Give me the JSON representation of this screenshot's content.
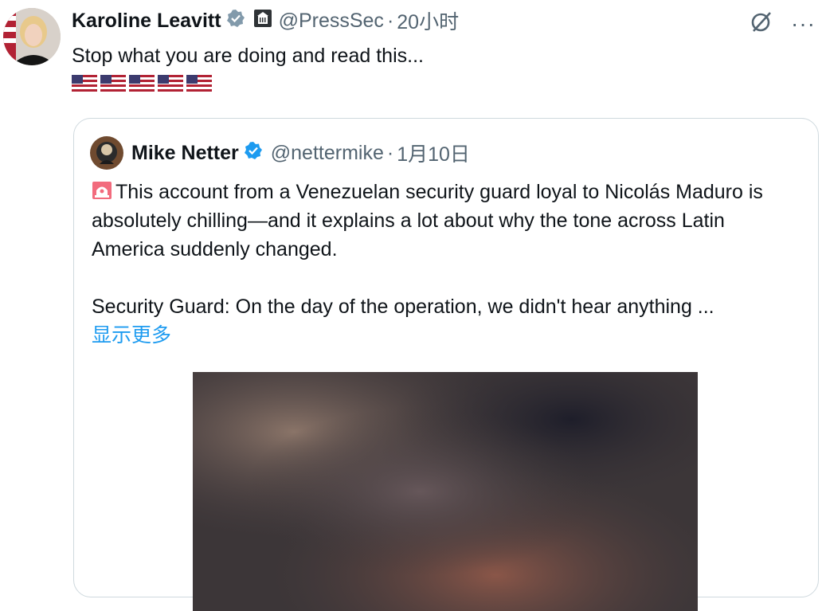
{
  "post": {
    "author_name": "Karoline Leavitt",
    "handle": "@PressSec",
    "separator": "·",
    "time": "20小时",
    "text": "Stop what you are doing and read this...",
    "flags": [
      "🇺🇸",
      "🇺🇸",
      "🇺🇸",
      "🇺🇸",
      "🇺🇸"
    ],
    "more_label": "···"
  },
  "quoted": {
    "author_name": "Mike Netter",
    "handle": "@nettermike",
    "separator": "·",
    "date": "1月10日",
    "line1": "This account from a Venezuelan security guard loyal to Nicolás Maduro is absolutely chilling—and it explains a lot about why the tone across Latin America suddenly changed.",
    "line2": "Security Guard: On the day of the operation, we didn't hear anything ...",
    "show_more": "显示更多"
  },
  "colors": {
    "verified_blue": "#1d9bf0",
    "verified_gray": "#829aab",
    "text": "#0f1419",
    "muted": "#536471",
    "link": "#1d9bf0"
  },
  "icons": [
    "gray-verified-badge-icon",
    "government-building-icon",
    "grok-icon",
    "more-icon",
    "blue-verified-badge-icon",
    "siren-icon",
    "us-flag-icon"
  ]
}
